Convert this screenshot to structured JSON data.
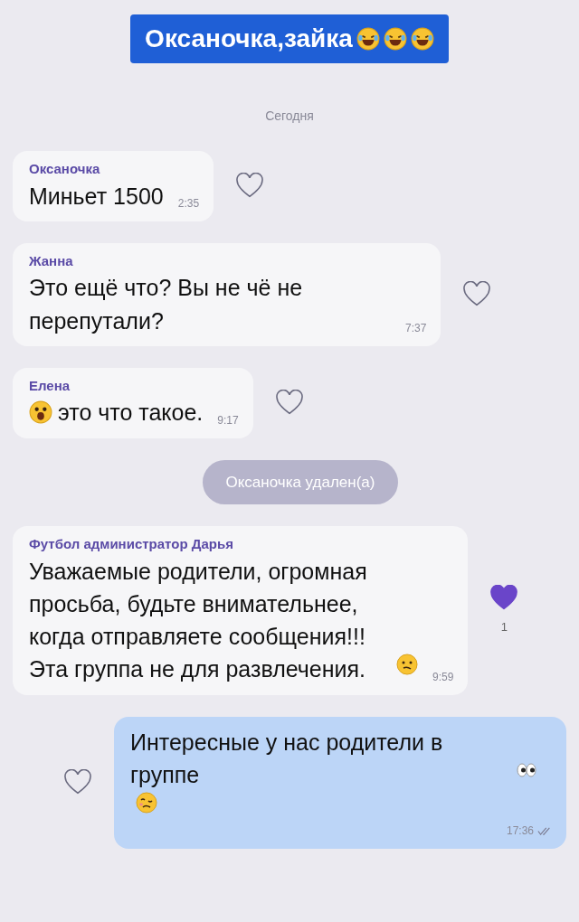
{
  "title": {
    "text": "Оксаночка,зайка",
    "trailing_icons": [
      {
        "kind": "laugh"
      },
      {
        "kind": "laugh"
      },
      {
        "kind": "laugh"
      }
    ]
  },
  "date_divider": "Сегодня",
  "messages": [
    {
      "kind": "incoming",
      "sender": "Оксаночка",
      "text": "Миньет 1500",
      "time": "2:35",
      "liked": false
    },
    {
      "kind": "incoming",
      "sender": "Жанна",
      "text": "Это ещё что? Вы не чё не перепутали?",
      "time": "7:37",
      "liked": false
    },
    {
      "kind": "incoming",
      "sender": "Елена",
      "leading_icons": [
        {
          "kind": "shocked"
        }
      ],
      "text": "это что такое.",
      "time": "9:17",
      "liked": false
    },
    {
      "kind": "system",
      "text": "Оксаночка удален(а)"
    },
    {
      "kind": "incoming",
      "sender": "Футбол администратор Дарья",
      "text": "Уважаемые родители, огромная просьба, будьте внимательнее, когда отправляете сообщения!!! Эта группа не для развлечения.",
      "trailing_icons": [
        {
          "kind": "confused"
        }
      ],
      "time": "9:59",
      "liked": true,
      "like_count": "1"
    },
    {
      "kind": "outgoing",
      "text": "Интересные у нас родители в группе",
      "trailing_icons": [
        {
          "kind": "eyes"
        },
        {
          "kind": "woozy"
        }
      ],
      "time": "17:36",
      "read": true,
      "liked": false
    }
  ]
}
